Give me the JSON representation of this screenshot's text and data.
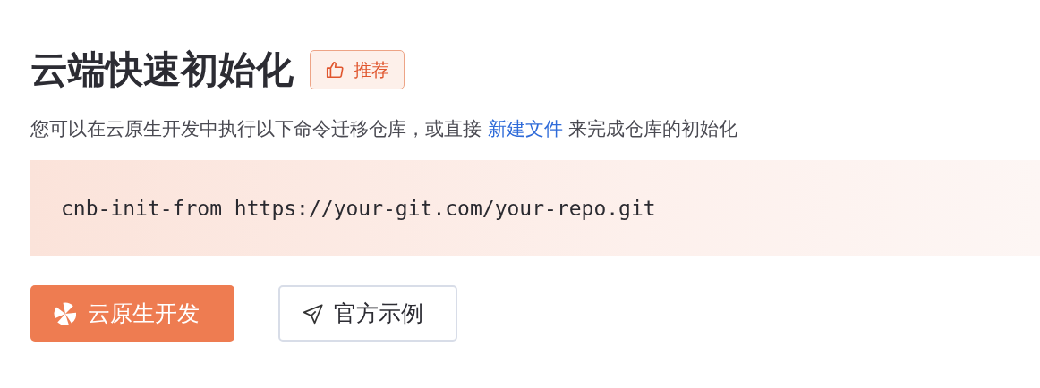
{
  "title": "云端快速初始化",
  "badge": {
    "label": "推荐"
  },
  "description": {
    "before": "您可以在云原生开发中执行以下命令迁移仓库，或直接 ",
    "link": "新建文件",
    "after": " 来完成仓库的初始化"
  },
  "command": "cnb-init-from https://your-git.com/your-repo.git",
  "buttons": [
    {
      "kind": "primary",
      "label": "云原生开发"
    },
    {
      "kind": "secondary",
      "label": "官方示例"
    }
  ]
}
